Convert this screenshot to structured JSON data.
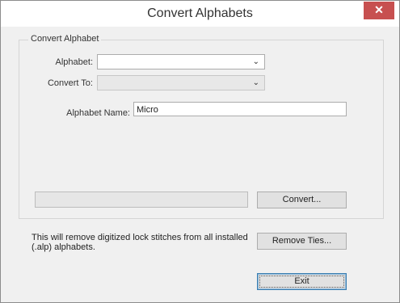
{
  "window": {
    "title": "Convert Alphabets",
    "close_label": "✕"
  },
  "group": {
    "legend": "Convert Alphabet"
  },
  "alphabet": {
    "label": "Alphabet:",
    "value": ""
  },
  "convert_to": {
    "label": "Convert To:",
    "value": ""
  },
  "alphabet_name": {
    "label": "Alphabet Name:",
    "value": "Micro"
  },
  "buttons": {
    "convert": "Convert...",
    "remove_ties": "Remove Ties...",
    "exit": "Exit"
  },
  "info_text": "This  will remove digitized lock stitches from all installed (.alp) alphabets."
}
